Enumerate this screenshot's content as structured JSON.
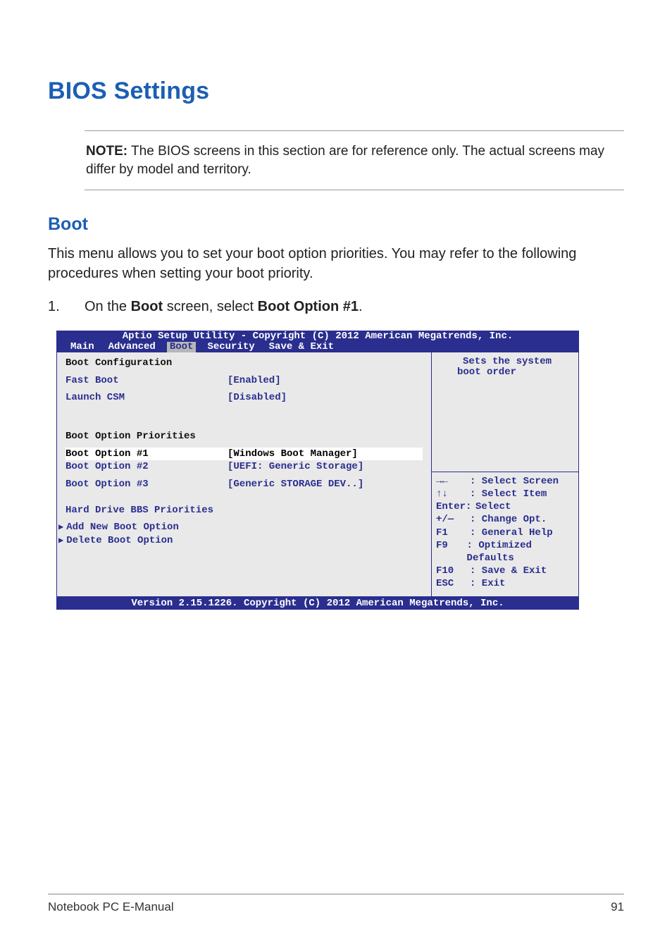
{
  "heading": "BIOS Settings",
  "note": {
    "label": "NOTE:",
    "text": " The BIOS screens in this section are for reference only. The actual screens may differ by model and territory."
  },
  "subheading": "Boot",
  "intro": "This menu allows you to set your boot option priorities. You may refer to the following procedures when setting your boot priority.",
  "step": {
    "num": "1.",
    "pre": "On the ",
    "b1": "Boot",
    "mid": " screen, select ",
    "b2": "Boot Option #1",
    "post": "."
  },
  "bios": {
    "title": "Aptio Setup Utility - Copyright (C) 2012 American Megatrends, Inc.",
    "tabs": [
      "Main",
      "Advanced",
      "Boot",
      "Security",
      "Save & Exit"
    ],
    "section1": "Boot Configuration",
    "rows1": [
      {
        "lbl": "Fast Boot",
        "val": "[Enabled]"
      },
      {
        "lbl": "Launch CSM",
        "val": "[Disabled]"
      }
    ],
    "section2": "Boot Option Priorities",
    "rows2": [
      {
        "lbl": "Boot Option #1",
        "val": "[Windows Boot Manager]",
        "hl": true
      },
      {
        "lbl": "Boot Option #2",
        "val": "[UEFI: Generic Storage]"
      },
      {
        "lbl": "Boot Option #3",
        "val": "[Generic STORAGE DEV..]"
      }
    ],
    "hdd_link": "Hard Drive BBS Priorities",
    "add_link": "Add New Boot Option",
    "del_link": "Delete Boot Option",
    "help1": "Sets the system",
    "help2": "boot order",
    "hotkeys": [
      {
        "k": "→←",
        "d": ": Select Screen"
      },
      {
        "k": "↑↓",
        "d": ": Select Item"
      },
      {
        "k": "Enter:",
        "d": "Select",
        "merged": true
      },
      {
        "k": "+/—",
        "d": ": Change Opt."
      },
      {
        "k": "F1",
        "d": ": General Help"
      },
      {
        "k": "F9",
        "d": ": Optimized Defaults"
      },
      {
        "k": "F10",
        "d": ": Save & Exit"
      },
      {
        "k": "ESC",
        "d": ": Exit"
      }
    ],
    "footer": "Version 2.15.1226. Copyright (C) 2012 American Megatrends, Inc."
  },
  "page_footer": {
    "left": "Notebook PC E-Manual",
    "right": "91"
  }
}
